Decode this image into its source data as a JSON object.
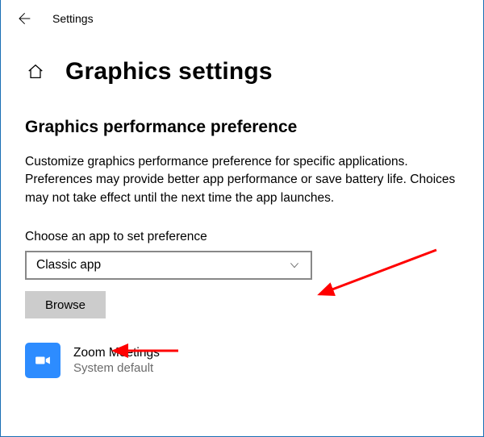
{
  "topbar": {
    "title": "Settings"
  },
  "page": {
    "title": "Graphics settings"
  },
  "section": {
    "title": "Graphics performance preference",
    "description": "Customize graphics performance preference for specific applications. Preferences may provide better app performance or save battery life. Choices may not take effect until the next time the app launches.",
    "choose_label": "Choose an app to set preference"
  },
  "dropdown": {
    "selected": "Classic app"
  },
  "buttons": {
    "browse": "Browse"
  },
  "apps": [
    {
      "name": "Zoom Meetings",
      "status": "System default"
    }
  ]
}
